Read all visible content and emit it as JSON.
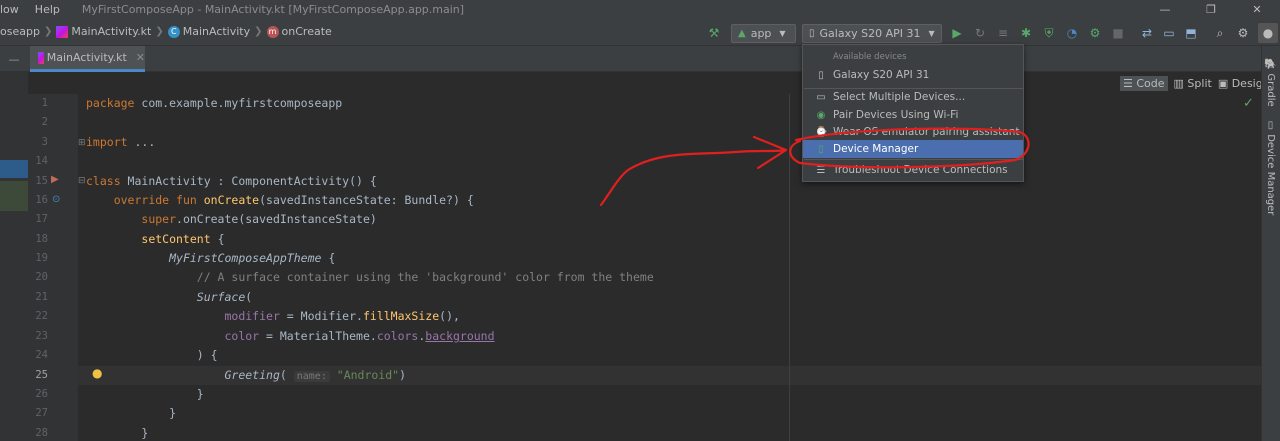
{
  "menu": {
    "items": [
      "low",
      "Help"
    ]
  },
  "window": {
    "title": "MyFirstComposeApp - MainActivity.kt [MyFirstComposeApp.app.main]"
  },
  "breadcrumb": {
    "items": [
      "oseapp",
      "MainActivity.kt",
      "MainActivity",
      "onCreate"
    ]
  },
  "toolbar": {
    "module_combo": "app",
    "device_combo": "Galaxy S20  API 31"
  },
  "tabs": [
    {
      "label": "MainActivity.kt"
    }
  ],
  "view_modes": {
    "code": "Code",
    "split": "Split",
    "design": "Design"
  },
  "side_tools": {
    "gradle": "Gradle",
    "device_manager": "Device Manager"
  },
  "editor": {
    "active_line": "25",
    "lines": [
      {
        "n": "1",
        "parts": [
          [
            "kw",
            "package "
          ],
          [
            "",
            "com.example.myfirstcomposeapp"
          ]
        ]
      },
      {
        "n": "2",
        "parts": []
      },
      {
        "n": "3",
        "parts": [
          [
            "kw",
            "import "
          ],
          [
            "",
            "..."
          ]
        ]
      },
      {
        "n": "14",
        "parts": []
      },
      {
        "n": "15",
        "parts": [
          [
            "kw",
            "class "
          ],
          [
            "",
            "MainActivity : ComponentActivity() {"
          ]
        ]
      },
      {
        "n": "16",
        "parts": [
          [
            "",
            "    "
          ],
          [
            "kw",
            "override fun "
          ],
          [
            "fn",
            "onCreate"
          ],
          [
            "",
            "(savedInstanceState: Bundle?) {"
          ]
        ]
      },
      {
        "n": "17",
        "parts": [
          [
            "",
            "        "
          ],
          [
            "kw",
            "super"
          ],
          [
            "",
            ".onCreate(savedInstanceState)"
          ]
        ]
      },
      {
        "n": "18",
        "parts": [
          [
            "",
            "        "
          ],
          [
            "fn",
            "setContent"
          ],
          [
            "",
            " {"
          ]
        ]
      },
      {
        "n": "19",
        "parts": [
          [
            "",
            "            "
          ],
          [
            "it",
            "MyFirstComposeAppTheme"
          ],
          [
            "",
            " {"
          ]
        ]
      },
      {
        "n": "20",
        "parts": [
          [
            "",
            "                "
          ],
          [
            "cm",
            "// A surface container using the 'background' color from the theme"
          ]
        ]
      },
      {
        "n": "21",
        "parts": [
          [
            "",
            "                "
          ],
          [
            "it",
            "Surface"
          ],
          [
            "",
            "("
          ]
        ]
      },
      {
        "n": "22",
        "parts": [
          [
            "",
            "                    "
          ],
          [
            "pr",
            "modifier"
          ],
          [
            "",
            " = Modifier."
          ],
          [
            "fn",
            "fillMaxSize"
          ],
          [
            "",
            "(),"
          ]
        ]
      },
      {
        "n": "23",
        "parts": [
          [
            "",
            "                    "
          ],
          [
            "pr",
            "color"
          ],
          [
            "",
            " = MaterialTheme."
          ],
          [
            "pr",
            "colors"
          ],
          [
            "",
            "."
          ],
          [
            "prund",
            "background"
          ]
        ]
      },
      {
        "n": "24",
        "parts": [
          [
            "",
            "                ) {"
          ]
        ]
      },
      {
        "n": "25",
        "parts": [
          [
            "",
            "                    "
          ],
          [
            "it",
            "Greeting"
          ],
          [
            "",
            "( "
          ],
          [
            "hint",
            "name:"
          ],
          [
            "str",
            " \"Android\""
          ],
          [
            "",
            ")"
          ]
        ]
      },
      {
        "n": "26",
        "parts": [
          [
            "",
            "                }"
          ]
        ]
      },
      {
        "n": "27",
        "parts": [
          [
            "",
            "            }"
          ]
        ]
      },
      {
        "n": "28",
        "parts": [
          [
            "",
            "        }"
          ]
        ]
      }
    ]
  },
  "device_dropdown": {
    "header": "Available devices",
    "device": "Galaxy S20  API 31",
    "actions": [
      {
        "label": "Select Multiple Devices...",
        "icon": "device-icon"
      },
      {
        "label": "Pair Devices Using Wi-Fi",
        "icon": "wifi-icon"
      },
      {
        "label": "Wear OS emulator pairing assistant",
        "icon": "watch-icon"
      },
      {
        "label": "Device Manager",
        "icon": "device-manager-icon",
        "selected": true
      },
      {
        "label": "Troubleshoot Device Connections",
        "icon": "list-icon"
      }
    ]
  },
  "annotation": {
    "color": "#e0201e"
  },
  "colors": {
    "accent": "#4b6eaf",
    "run": "#4caf50",
    "keyword": "#cc7832",
    "function": "#ffc66d"
  }
}
